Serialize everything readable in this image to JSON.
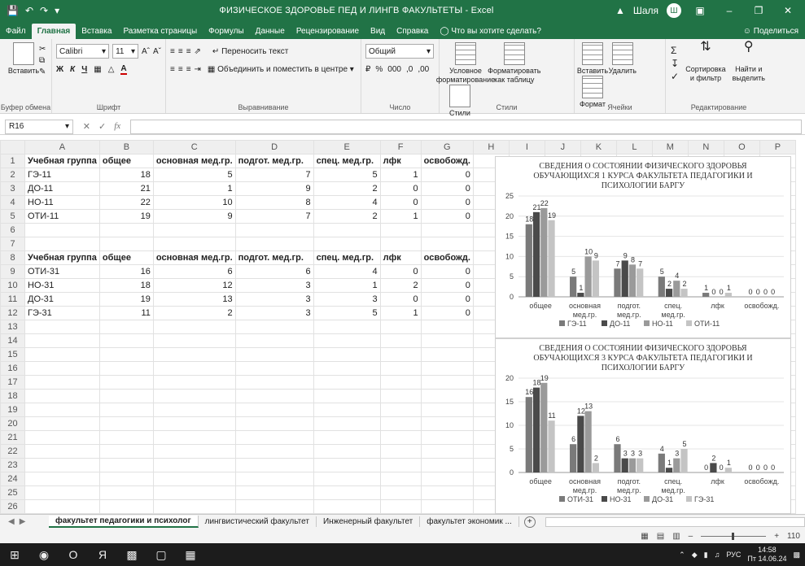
{
  "titlebar": {
    "title": "ФИЗИЧЕСКОЕ ЗДОРОВЬЕ ПЕД И ЛИНГВ ФАКУЛЬТЕТЫ  -  Excel",
    "user": "Шаля",
    "user_initial": "Ш"
  },
  "menu": {
    "tabs": [
      "Файл",
      "Главная",
      "Вставка",
      "Разметка страницы",
      "Формулы",
      "Данные",
      "Рецензирование",
      "Вид",
      "Справка"
    ],
    "tell_me": "Что вы хотите сделать?",
    "share": "Поделиться"
  },
  "ribbon": {
    "clipboard": {
      "paste": "Вставить",
      "label": "Буфер обмена"
    },
    "font": {
      "name": "Calibri",
      "size": "11",
      "label": "Шрифт"
    },
    "alignment": {
      "wrap": "Переносить текст",
      "merge": "Объединить и поместить в центре",
      "label": "Выравнивание"
    },
    "number": {
      "format": "Общий",
      "label": "Число"
    },
    "styles": {
      "conditional": "Условное форматирование",
      "format_table": "Форматировать как таблицу",
      "cell_styles": "Стили ячеек",
      "label": "Стили"
    },
    "cells": {
      "insert": "Вставить",
      "delete": "Удалить",
      "format": "Формат",
      "label": "Ячейки"
    },
    "editing": {
      "sort": "Сортировка и фильтр",
      "find": "Найти и выделить",
      "label": "Редактирование"
    }
  },
  "formula_bar": {
    "name_box": "R16",
    "fx": "fx",
    "value": ""
  },
  "columns": [
    "A",
    "B",
    "C",
    "D",
    "E",
    "F",
    "G",
    "H",
    "I",
    "J",
    "K",
    "L",
    "M",
    "N",
    "O",
    "P"
  ],
  "rows": [
    [
      "Учебная группа",
      "общее",
      "основная мед.гр.",
      "подгот. мед.гр.",
      "спец. мед.гр.",
      "лфк",
      "освобожд."
    ],
    [
      "ГЭ-11",
      "18",
      "5",
      "7",
      "5",
      "1",
      "0"
    ],
    [
      "ДО-11",
      "21",
      "1",
      "9",
      "2",
      "0",
      "0"
    ],
    [
      "НО-11",
      "22",
      "10",
      "8",
      "4",
      "0",
      "0"
    ],
    [
      "ОТИ-11",
      "19",
      "9",
      "7",
      "2",
      "1",
      "0"
    ],
    [
      "",
      "",
      "",
      "",
      "",
      "",
      ""
    ],
    [
      "",
      "",
      "",
      "",
      "",
      "",
      ""
    ],
    [
      "Учебная группа",
      "общее",
      "основная мед.гр.",
      "подгот. мед.гр.",
      "спец. мед.гр.",
      "лфк",
      "освобожд."
    ],
    [
      "ОТИ-31",
      "16",
      "6",
      "6",
      "4",
      "0",
      "0"
    ],
    [
      "НО-31",
      "18",
      "12",
      "3",
      "1",
      "2",
      "0"
    ],
    [
      "ДО-31",
      "19",
      "13",
      "3",
      "3",
      "0",
      "0"
    ],
    [
      "ГЭ-31",
      "11",
      "2",
      "3",
      "5",
      "1",
      "0"
    ]
  ],
  "total_rows": 26,
  "chart_data": [
    {
      "type": "bar",
      "title": "СВЕДЕНИЯ О СОСТОЯНИИ ФИЗИЧЕСКОГО ЗДОРОВЬЯ ОБУЧАЮЩИХСЯ 1 КУРСА ФАКУЛЬТЕТА ПЕДАГОГИКИ И ПСИХОЛОГИИ БАРГУ",
      "categories": [
        "общее",
        "основная мед.гр.",
        "подгот. мед.гр.",
        "спец. мед.гр.",
        "лфк",
        "освобожд."
      ],
      "series": [
        {
          "name": "ГЭ-11",
          "color": "#7a7a7a",
          "values": [
            18,
            5,
            7,
            5,
            1,
            0
          ]
        },
        {
          "name": "ДО-11",
          "color": "#4a4a4a",
          "values": [
            21,
            1,
            9,
            2,
            0,
            0
          ]
        },
        {
          "name": "НО-11",
          "color": "#9a9a9a",
          "values": [
            22,
            10,
            8,
            4,
            0,
            0
          ]
        },
        {
          "name": "ОТИ-11",
          "color": "#c4c4c4",
          "values": [
            19,
            9,
            7,
            2,
            1,
            0
          ]
        }
      ],
      "yticks": [
        0,
        5,
        10,
        15,
        20,
        25
      ],
      "ylim": [
        0,
        25
      ],
      "legend": "bottom"
    },
    {
      "type": "bar",
      "title": "СВЕДЕНИЯ О СОСТОЯНИИ ФИЗИЧЕСКОГО ЗДОРОВЬЯ ОБУЧАЮЩИХСЯ 3 КУРСА ФАКУЛЬТЕТА ПЕДАГОГИКИ И ПСИХОЛОГИИ БАРГУ",
      "categories": [
        "общее",
        "основная мед.гр.",
        "подгот. мед.гр.",
        "спец. мед.гр.",
        "лфк",
        "освобожд."
      ],
      "series": [
        {
          "name": "ОТИ-31",
          "color": "#7a7a7a",
          "values": [
            16,
            6,
            6,
            4,
            0,
            0
          ]
        },
        {
          "name": "НО-31",
          "color": "#4a4a4a",
          "values": [
            18,
            12,
            3,
            1,
            2,
            0
          ]
        },
        {
          "name": "ДО-31",
          "color": "#9a9a9a",
          "values": [
            19,
            13,
            3,
            3,
            0,
            0
          ]
        },
        {
          "name": "ГЭ-31",
          "color": "#c4c4c4",
          "values": [
            11,
            2,
            3,
            5,
            1,
            0
          ]
        }
      ],
      "yticks": [
        0,
        5,
        10,
        15,
        20
      ],
      "ylim": [
        0,
        20
      ],
      "legend": "bottom"
    }
  ],
  "sheet_tabs": [
    "факультет педагогики и психолог",
    "лингвистический факультет",
    "Инженерный факультет",
    "факультет экономик ..."
  ],
  "status": {
    "zoom": "110"
  },
  "taskbar": {
    "lang": "РУС",
    "time": "14:58",
    "date": "Пт 14.06.24"
  }
}
